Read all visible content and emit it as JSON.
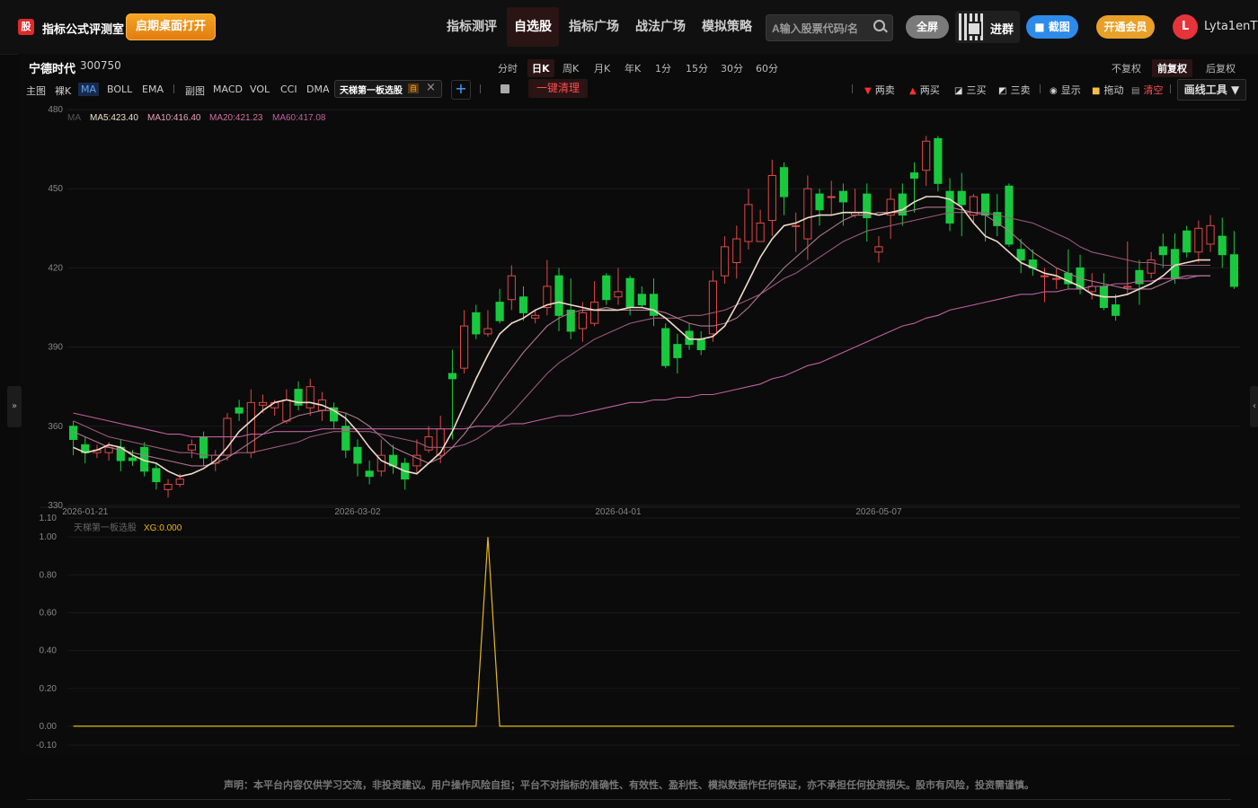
{
  "app": {
    "logo_text": "股",
    "title": "指标公式评测室",
    "open_desktop": "启期桌面打开"
  },
  "nav": [
    {
      "label": "指标测评"
    },
    {
      "label": "自选股"
    },
    {
      "label": "指标广场"
    },
    {
      "label": "战法广场"
    },
    {
      "label": "模拟策略"
    }
  ],
  "search": {
    "placeholder": "A输入股票代码/名"
  },
  "header_buttons": {
    "fullscreen": "全屏",
    "join_group": "进群",
    "screenshot": "截图",
    "vip": "开通会员"
  },
  "user": {
    "avatar": "L",
    "name": "Lyta1enT"
  },
  "stock": {
    "name": "宁德时代",
    "code": "300750"
  },
  "periods": [
    "分时",
    "日K",
    "周K",
    "月K",
    "年K",
    "1分",
    "15分",
    "30分",
    "60分"
  ],
  "adjust": [
    "不复权",
    "前复权",
    "后复权"
  ],
  "toolbar_left": [
    "主图",
    "裸K",
    "MA",
    "BOLL",
    "EMA",
    "副图",
    "MACD",
    "VOL",
    "CCI",
    "DMA"
  ],
  "indicator_tag": {
    "label": "天梯第一板选股",
    "self": "自"
  },
  "clear_button": "一键清理",
  "toolbar_right": {
    "sell2": "两卖",
    "buy2": "两买",
    "buy3": "三买",
    "sell3": "三卖",
    "show": "显示",
    "drag": "拖动",
    "clear": "清空",
    "draw_tools": "画线工具 ▼"
  },
  "ma_legend": {
    "prefix": "MA",
    "ma5": "MA5:423.40",
    "ma10": "MA10:416.40",
    "ma20": "MA20:421.23",
    "ma60": "MA60:417.08"
  },
  "sub_legend": {
    "name": "天梯第一板选股",
    "value": "XG:0.000"
  },
  "colors": {
    "up": "#e04848",
    "down": "#18c93f",
    "ma5": "#f0dcc8",
    "ma10": "#b07890",
    "ma20": "#9a5a78",
    "ma60": "#c060a0",
    "xg": "#e8b818"
  },
  "chart_data": {
    "type": "candlestick",
    "ylim": [
      330,
      480
    ],
    "yticks": [
      480,
      450,
      420,
      390,
      360,
      330
    ],
    "xticks": [
      {
        "index": 1,
        "label": "2026-01-21"
      },
      {
        "index": 24,
        "label": "2026-03-02"
      },
      {
        "index": 46,
        "label": "2026-04-01"
      },
      {
        "index": 68,
        "label": "2026-05-07"
      }
    ],
    "candles": [
      [
        360,
        355,
        362,
        349
      ],
      [
        353,
        350,
        356,
        346
      ],
      [
        350,
        351,
        353,
        348
      ],
      [
        350,
        352,
        354,
        347
      ],
      [
        352,
        347,
        355,
        343
      ],
      [
        348,
        347,
        351,
        345
      ],
      [
        352,
        343,
        354,
        341
      ],
      [
        344,
        339,
        346,
        336
      ],
      [
        336,
        338,
        340,
        333
      ],
      [
        338,
        340,
        342,
        337
      ],
      [
        351,
        353,
        355,
        348
      ],
      [
        356,
        348,
        358,
        345
      ],
      [
        346,
        349,
        351,
        343
      ],
      [
        349,
        363,
        365,
        347
      ],
      [
        367,
        365,
        370,
        362
      ],
      [
        350,
        369,
        374,
        348
      ],
      [
        368,
        369,
        372,
        365
      ],
      [
        367,
        369,
        370,
        364
      ],
      [
        362,
        370,
        374,
        361
      ],
      [
        374,
        368,
        377,
        366
      ],
      [
        367,
        375,
        378,
        364
      ],
      [
        366,
        370,
        373,
        362
      ],
      [
        367,
        362,
        369,
        359
      ],
      [
        360,
        351,
        365,
        348
      ],
      [
        352,
        346,
        355,
        341
      ],
      [
        343,
        341,
        347,
        338
      ],
      [
        343,
        349,
        355,
        341
      ],
      [
        349,
        345,
        353,
        342
      ],
      [
        346,
        340,
        348,
        336
      ],
      [
        345,
        349,
        355,
        342
      ],
      [
        351,
        356,
        360,
        350
      ],
      [
        349,
        359,
        364,
        346
      ],
      [
        380,
        378,
        389,
        355
      ],
      [
        382,
        398,
        404,
        380
      ],
      [
        403,
        395,
        406,
        393
      ],
      [
        395,
        397,
        404,
        394
      ],
      [
        407,
        400,
        412,
        399
      ],
      [
        408,
        417,
        421,
        404
      ],
      [
        409,
        403,
        413,
        400
      ],
      [
        401,
        402,
        404,
        399
      ],
      [
        405,
        413,
        423,
        402
      ],
      [
        417,
        402,
        420,
        396
      ],
      [
        404,
        396,
        416,
        393
      ],
      [
        397,
        403,
        407,
        392
      ],
      [
        399,
        407,
        415,
        398
      ],
      [
        417,
        408,
        418,
        406
      ],
      [
        409,
        411,
        420,
        406
      ],
      [
        416,
        405,
        417,
        402
      ],
      [
        410,
        406,
        413,
        405
      ],
      [
        410,
        402,
        416,
        398
      ],
      [
        397,
        383,
        399,
        382
      ],
      [
        391,
        386,
        395,
        380
      ],
      [
        396,
        391,
        399,
        389
      ],
      [
        393,
        389,
        396,
        387
      ],
      [
        395,
        415,
        419,
        392
      ],
      [
        417,
        428,
        432,
        414
      ],
      [
        422,
        431,
        436,
        416
      ],
      [
        430,
        444,
        450,
        427
      ],
      [
        430,
        437,
        442,
        431
      ],
      [
        438,
        455,
        461,
        432
      ],
      [
        458,
        447,
        460,
        440
      ],
      [
        436,
        436,
        441,
        426
      ],
      [
        431,
        450,
        455,
        423
      ],
      [
        448,
        442,
        450,
        436
      ],
      [
        447,
        447,
        453,
        440
      ],
      [
        449,
        445,
        452,
        436
      ],
      [
        440,
        441,
        450,
        439
      ],
      [
        448,
        439,
        452,
        430
      ],
      [
        426,
        428,
        432,
        422
      ],
      [
        440,
        446,
        450,
        431
      ],
      [
        448,
        440,
        452,
        436
      ],
      [
        456,
        454,
        460,
        441
      ],
      [
        457,
        468,
        470,
        451
      ],
      [
        469,
        452,
        470,
        449
      ],
      [
        449,
        437,
        454,
        434
      ],
      [
        449,
        444,
        456,
        432
      ],
      [
        440,
        447,
        448,
        437
      ],
      [
        448,
        440,
        448,
        430
      ],
      [
        441,
        436,
        448,
        432
      ],
      [
        451,
        429,
        452,
        428
      ],
      [
        427,
        423,
        431,
        418
      ],
      [
        423,
        420,
        427,
        417
      ],
      [
        417,
        417,
        420,
        407
      ],
      [
        416,
        416,
        420,
        412
      ],
      [
        418,
        414,
        427,
        412
      ],
      [
        420,
        412,
        425,
        410
      ],
      [
        411,
        413,
        418,
        408
      ],
      [
        413,
        405,
        418,
        404
      ],
      [
        406,
        402,
        410,
        400
      ],
      [
        413,
        413,
        430,
        410
      ],
      [
        419,
        414,
        423,
        406
      ],
      [
        418,
        423,
        426,
        416
      ],
      [
        428,
        425,
        433,
        420
      ],
      [
        427,
        416,
        433,
        414
      ],
      [
        434,
        426,
        436,
        424
      ],
      [
        426,
        435,
        438,
        422
      ],
      [
        429,
        436,
        440,
        426
      ],
      [
        432,
        425,
        439,
        420
      ],
      [
        425,
        413,
        434,
        412
      ]
    ],
    "ma5": [
      352,
      350,
      351,
      353,
      352,
      349,
      347,
      346,
      343,
      341,
      342,
      344,
      347,
      352,
      358,
      362,
      366,
      369,
      370,
      369,
      369,
      368,
      366,
      363,
      358,
      352,
      347,
      345,
      343,
      342,
      346,
      350,
      358,
      368,
      378,
      387,
      395,
      399,
      401,
      404,
      406,
      407,
      406,
      405,
      404,
      404,
      404,
      405,
      405,
      404,
      401,
      397,
      393,
      393,
      394,
      398,
      406,
      415,
      424,
      431,
      436,
      437,
      439,
      440,
      440,
      441,
      441,
      441,
      440,
      441,
      442,
      445,
      447,
      447,
      446,
      443,
      437,
      432,
      430,
      426,
      422,
      420,
      418,
      417,
      415,
      413,
      410,
      409,
      409,
      410,
      412,
      414,
      417,
      421,
      422,
      423,
      423
    ],
    "ma10": [
      358,
      356,
      354,
      352,
      351,
      350,
      349,
      348,
      347,
      346,
      345,
      345,
      346,
      348,
      351,
      354,
      357,
      360,
      362,
      364,
      365,
      366,
      366,
      365,
      363,
      360,
      356,
      352,
      350,
      348,
      346,
      348,
      352,
      357,
      363,
      369,
      376,
      382,
      388,
      393,
      398,
      401,
      403,
      404,
      404,
      405,
      404,
      404,
      404,
      404,
      403,
      401,
      399,
      398,
      398,
      399,
      401,
      405,
      410,
      415,
      420,
      424,
      428,
      432,
      435,
      438,
      440,
      440,
      441,
      441,
      441,
      442,
      443,
      443,
      443,
      442,
      441,
      440,
      437,
      434,
      430,
      426,
      423,
      420,
      418,
      416,
      415,
      414,
      413,
      412,
      412,
      412,
      414,
      416,
      417,
      417,
      417
    ],
    "ma20": [
      362,
      360,
      358,
      356,
      355,
      354,
      353,
      352,
      351,
      350,
      350,
      349,
      349,
      349,
      350,
      350,
      351,
      352,
      353,
      354,
      356,
      357,
      358,
      358,
      358,
      358,
      357,
      356,
      355,
      354,
      352,
      352,
      352,
      353,
      355,
      358,
      361,
      365,
      370,
      375,
      380,
      384,
      387,
      390,
      393,
      395,
      397,
      399,
      400,
      401,
      401,
      401,
      402,
      402,
      403,
      404,
      406,
      408,
      410,
      413,
      416,
      418,
      421,
      424,
      427,
      430,
      432,
      434,
      435,
      436,
      437,
      438,
      439,
      440,
      441,
      441,
      441,
      441,
      440,
      439,
      438,
      437,
      435,
      433,
      431,
      428,
      426,
      425,
      424,
      423,
      422,
      422,
      421,
      421,
      421,
      421,
      421
    ],
    "ma60": [
      365,
      364,
      363,
      362,
      361,
      360,
      359,
      358,
      357,
      357,
      356,
      356,
      356,
      356,
      356,
      357,
      357,
      358,
      358,
      358,
      358,
      359,
      359,
      359,
      359,
      359,
      359,
      359,
      359,
      359,
      359,
      359,
      359,
      359,
      360,
      360,
      360,
      361,
      361,
      362,
      363,
      364,
      364,
      365,
      366,
      367,
      368,
      369,
      369,
      370,
      370,
      371,
      371,
      372,
      372,
      373,
      374,
      375,
      376,
      378,
      379,
      381,
      383,
      384,
      386,
      388,
      390,
      392,
      394,
      396,
      398,
      399,
      401,
      402,
      404,
      405,
      406,
      407,
      408,
      409,
      410,
      410,
      411,
      411,
      412,
      412,
      413,
      413,
      414,
      414,
      415,
      415,
      416,
      416,
      416,
      417,
      417
    ],
    "sub": {
      "ylim": [
        -0.1,
        1.1
      ],
      "yticks": [
        1.1,
        1.0,
        0.8,
        0.6,
        0.4,
        0.2,
        0.0,
        -0.1
      ],
      "spike_index": 35,
      "values_note": "0 except spike of 1 at index 35"
    }
  }
}
